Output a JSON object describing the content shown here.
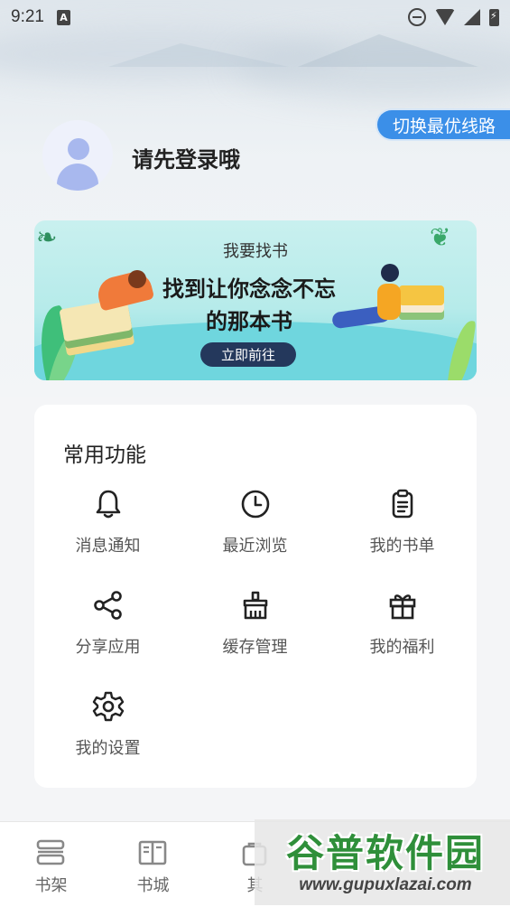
{
  "status_bar": {
    "time": "9:21",
    "a_badge": "A"
  },
  "switch_route": {
    "label": "切换最优线路"
  },
  "user": {
    "login_prompt": "请先登录哦"
  },
  "banner": {
    "title": "我要找书",
    "line1": "找到让你念念不忘",
    "line2": "的那本书",
    "button": "立即前往"
  },
  "functions": {
    "title": "常用功能",
    "items": [
      {
        "label": "消息通知",
        "icon": "bell-icon"
      },
      {
        "label": "最近浏览",
        "icon": "clock-icon"
      },
      {
        "label": "我的书单",
        "icon": "clipboard-icon"
      },
      {
        "label": "分享应用",
        "icon": "share-icon"
      },
      {
        "label": "缓存管理",
        "icon": "broom-icon"
      },
      {
        "label": "我的福利",
        "icon": "gift-icon"
      },
      {
        "label": "我的设置",
        "icon": "gear-icon"
      }
    ]
  },
  "bottom_nav": {
    "items": [
      {
        "label": "书架",
        "icon": "bookshelf-icon"
      },
      {
        "label": "书城",
        "icon": "book-icon"
      },
      {
        "label": "其",
        "icon": "bag-icon"
      }
    ]
  },
  "watermark": {
    "brand": "谷普软件园",
    "url": "www.gupuxlazai.com"
  },
  "colors": {
    "accent": "#3b8fe8",
    "banner_button": "#24385c",
    "card_bg": "#ffffff"
  }
}
